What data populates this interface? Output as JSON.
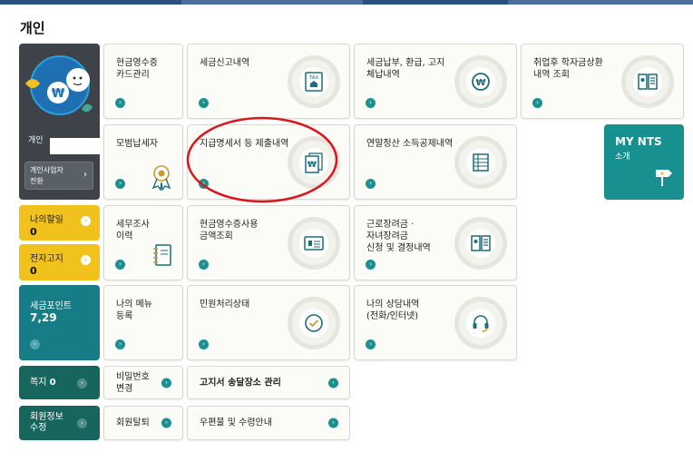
{
  "page": {
    "title": "개인"
  },
  "profile": {
    "name": "개인",
    "switch_line1": "개인사업자",
    "switch_line2": "전환",
    "switch_arrow": "›"
  },
  "left": {
    "discount": {
      "label": "나의할일",
      "count": "0"
    },
    "notice": {
      "label": "전자고지",
      "count": "0"
    },
    "points": {
      "label": "세금포인트",
      "value": "7,29"
    },
    "note": {
      "label": "쪽지",
      "count": "0"
    },
    "member_info": {
      "line1": "회원정보",
      "line2": "수정"
    }
  },
  "cards": {
    "cash_receipt_card": {
      "line1": "현금영수증",
      "line2": "카드관리"
    },
    "tax_report": {
      "line1": "세금신고내역"
    },
    "tax_payment": {
      "line1": "세금납부, 환급, 고지",
      "line2": "체납내역"
    },
    "student_loan": {
      "line1": "취업후 학자금상환",
      "line2": "내역 조회"
    },
    "model_taxpayer": {
      "line1": "모범납세자"
    },
    "payment_statement": {
      "line1": "지급명세서 등 제출내역"
    },
    "year_end": {
      "line1": "연말정산 소득공제내역"
    },
    "tax_audit": {
      "line1": "세무조사",
      "line2": "이력"
    },
    "cash_receipt_usage": {
      "line1": "현금영수증사용",
      "line2": "금액조회"
    },
    "earned_income": {
      "line1": "근로장려금 ·",
      "line2": "자녀장려금",
      "line3": "신청 및 결정내역"
    },
    "my_menu": {
      "line1": "나의 메뉴",
      "line2": "등록"
    },
    "civil_status": {
      "line1": "민원처리상태"
    },
    "consultation": {
      "line1": "나의 상담내역",
      "line2": "(전화/인터넷)"
    },
    "password_change": {
      "line1": "비밀번호",
      "line2": "변경"
    },
    "notice_address": {
      "line1": "고지서 송달장소 관리"
    },
    "withdraw": {
      "line1": "회원탈퇴"
    },
    "mail_receipt": {
      "line1": "우편물 및 수령안내"
    }
  },
  "mynts": {
    "title": "MY NTS",
    "subtitle": "소개"
  },
  "icons": {
    "arrow": "›",
    "won": "₩",
    "tax": "TAX"
  },
  "colors": {
    "teal": "#167c86",
    "dark_teal": "#16665d",
    "yellow": "#f1c21b",
    "highlight_oval": "#d9161b"
  }
}
